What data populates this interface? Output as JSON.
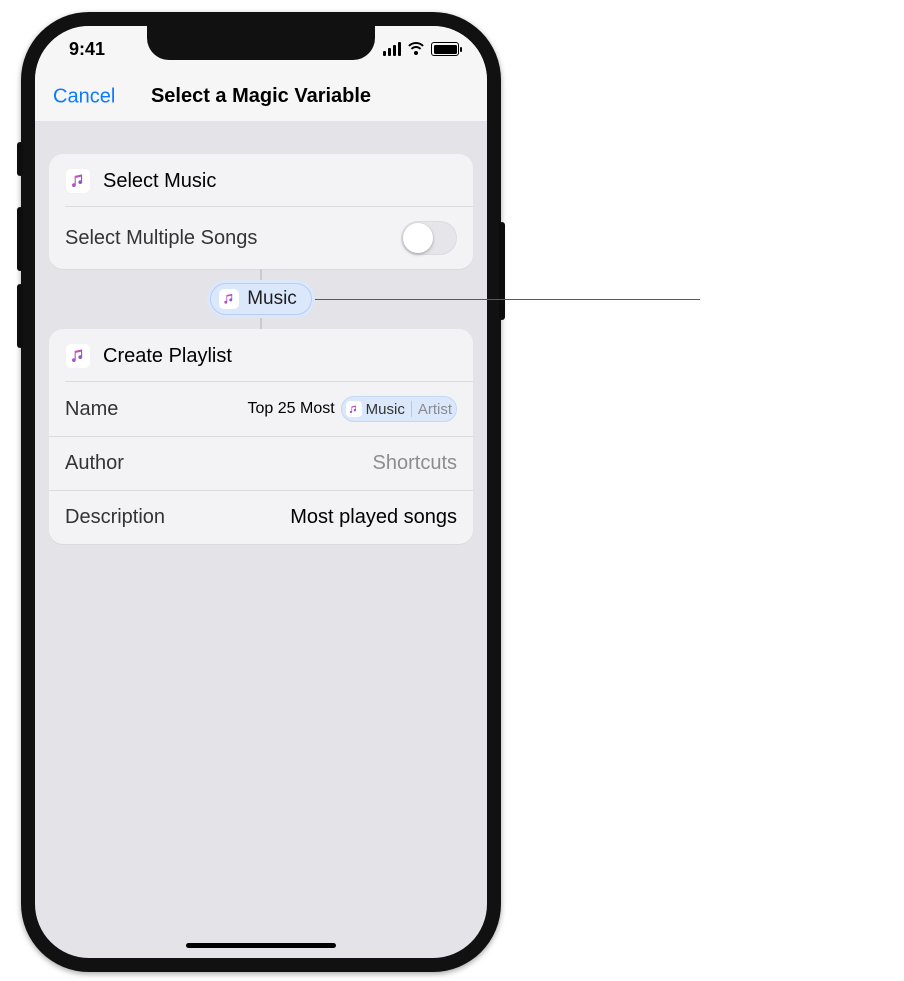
{
  "status": {
    "time": "9:41"
  },
  "nav": {
    "cancel": "Cancel",
    "title": "Select a Magic Variable"
  },
  "action1": {
    "title": "Select Music",
    "row_label": "Select Multiple Songs",
    "switch_on": false
  },
  "magic_var": {
    "label": "Music"
  },
  "action2": {
    "title": "Create Playlist",
    "rows": {
      "name": {
        "label": "Name",
        "text": "Top 25 Most",
        "token_main": "Music",
        "token_sub": "Artist"
      },
      "author": {
        "label": "Author",
        "value": "Shortcuts"
      },
      "desc": {
        "label": "Description",
        "value": "Most played songs"
      }
    }
  }
}
